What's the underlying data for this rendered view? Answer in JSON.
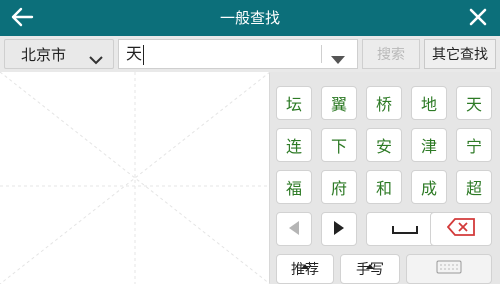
{
  "header": {
    "title": "一般查找",
    "back_icon": "back-arrow-icon",
    "close_icon": "close-icon",
    "color": "#0c6f7a"
  },
  "search": {
    "city": "北京市",
    "input_value": "天",
    "search_label": "搜索",
    "other_label": "其它查找"
  },
  "keyboard": {
    "rows": [
      [
        "坛",
        "翼",
        "桥",
        "地",
        "天"
      ],
      [
        "连",
        "下",
        "安",
        "津",
        "宁"
      ],
      [
        "福",
        "府",
        "和",
        "成",
        "超"
      ]
    ],
    "bottom_left": "推荐",
    "bottom_mid": "手写"
  },
  "colors": {
    "candidate_text": "#2d7a25",
    "delete_icon": "#d33a3a"
  }
}
